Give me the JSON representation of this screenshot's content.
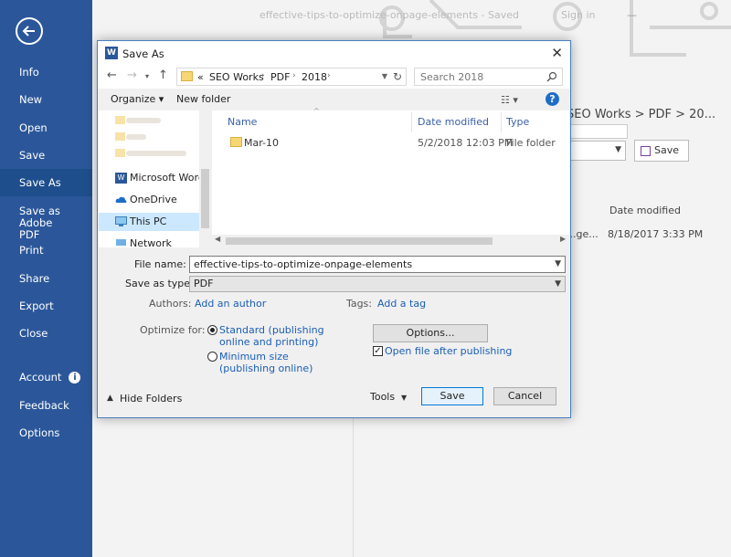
{
  "backstage": {
    "doc_title": "effective-tips-to-optimize-onpage-elements - Saved",
    "sign_in": "Sign in",
    "minimize": "—",
    "path_label": "SEO Works > PDF > 20...",
    "save_button": "Save",
    "date_modified_header": "Date modified",
    "row_name_tail": "...ge...",
    "row_date": "8/18/2017 3:33 PM",
    "accent_color": "#2b579a"
  },
  "sidebar": {
    "items": [
      {
        "label": "Info"
      },
      {
        "label": "New"
      },
      {
        "label": "Open"
      },
      {
        "label": "Save"
      },
      {
        "label": "Save As"
      },
      {
        "label": "Save as Adobe PDF"
      },
      {
        "label": "Print"
      },
      {
        "label": "Share"
      },
      {
        "label": "Export"
      },
      {
        "label": "Close"
      },
      {
        "label": "Account"
      },
      {
        "label": "Feedback"
      },
      {
        "label": "Options"
      }
    ]
  },
  "dialog": {
    "title": "Save As",
    "app_icon_letter": "W",
    "address": {
      "prefix": "«",
      "crumbs": [
        "SEO Works",
        "PDF",
        "2018"
      ]
    },
    "search_placeholder": "Search 2018",
    "toolbar": {
      "organize": "Organize ▾",
      "new_folder": "New folder"
    },
    "nav_pane": {
      "items": [
        {
          "label": "Microsoft Word",
          "icon": "word-icon"
        },
        {
          "label": "OneDrive",
          "icon": "cloud-icon"
        },
        {
          "label": "This PC",
          "icon": "computer-icon"
        },
        {
          "label": "Network",
          "icon": "network-icon"
        }
      ]
    },
    "columns": {
      "name": "Name",
      "date": "Date modified",
      "type": "Type"
    },
    "files": [
      {
        "name": "Mar-10",
        "date": "5/2/2018 12:03 PM",
        "type": "File folder"
      }
    ],
    "form": {
      "file_name_label": "File name:",
      "file_name_value": "effective-tips-to-optimize-onpage-elements",
      "save_type_label": "Save as type:",
      "save_type_value": "PDF",
      "authors_label": "Authors:",
      "authors_link": "Add an author",
      "tags_label": "Tags:",
      "tags_link": "Add a tag",
      "optimize_label": "Optimize for:",
      "opt_standard_1": "Standard (publishing",
      "opt_standard_2": "online and printing)",
      "opt_min_1": "Minimum size",
      "opt_min_2": "(publishing online)",
      "options_button": "Options...",
      "open_after": "Open file after publishing"
    },
    "footer": {
      "hide_folders": "Hide Folders",
      "tools": "Tools",
      "save": "Save",
      "cancel": "Cancel"
    }
  }
}
